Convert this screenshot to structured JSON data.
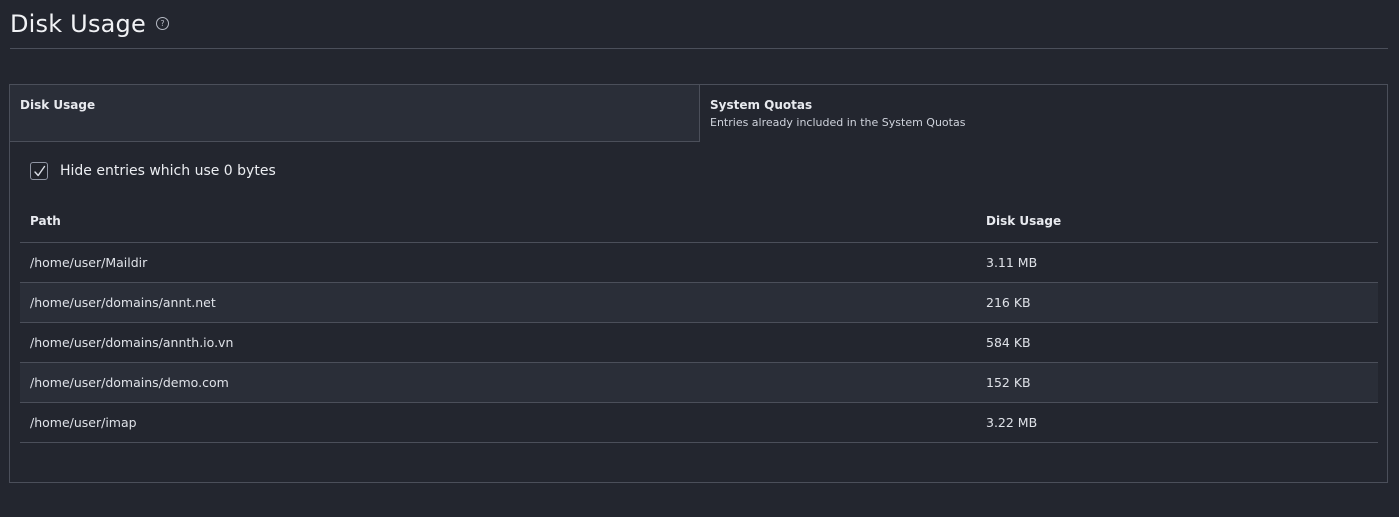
{
  "header": {
    "title": "Disk Usage",
    "help_icon": "help-circle-icon"
  },
  "tabs": [
    {
      "label": "Disk Usage",
      "description": "",
      "active": true
    },
    {
      "label": "System Quotas",
      "description": "Entries already included in the System Quotas",
      "active": false
    }
  ],
  "filter": {
    "label": "Hide entries which use 0 bytes",
    "checked": true
  },
  "table": {
    "columns": [
      "Path",
      "Disk Usage"
    ],
    "rows": [
      {
        "path": "/home/user/Maildir",
        "usage": "3.11 MB"
      },
      {
        "path": "/home/user/domains/annt.net",
        "usage": "216 KB"
      },
      {
        "path": "/home/user/domains/annth.io.vn",
        "usage": "584 KB"
      },
      {
        "path": "/home/user/domains/demo.com",
        "usage": "152 KB"
      },
      {
        "path": "/home/user/imap",
        "usage": "3.22 MB"
      }
    ]
  }
}
